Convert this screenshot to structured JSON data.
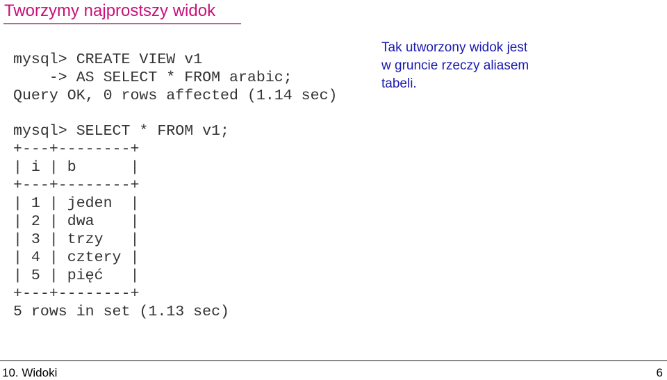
{
  "slide": {
    "title": "Tworzymy najprostszy widok",
    "code_block_1": [
      "mysql> CREATE VIEW v1",
      "    -> AS SELECT * FROM arabic;",
      "Query OK, 0 rows affected (1.14 sec)"
    ],
    "code_block_2": [
      "mysql> SELECT * FROM v1;",
      "+---+--------+",
      "| i | b      |",
      "+---+--------+",
      "| 1 | jeden  |",
      "| 2 | dwa    |",
      "| 3 | trzy   |",
      "| 4 | cztery |",
      "| 5 | pięć   |",
      "+---+--------+",
      "5 rows in set (1.13 sec)"
    ],
    "note_lines": [
      "Tak utworzony widok jest",
      "w gruncie rzeczy aliasem",
      "tabeli."
    ]
  },
  "footer": {
    "section": "10. Widoki",
    "page_number": "6"
  }
}
